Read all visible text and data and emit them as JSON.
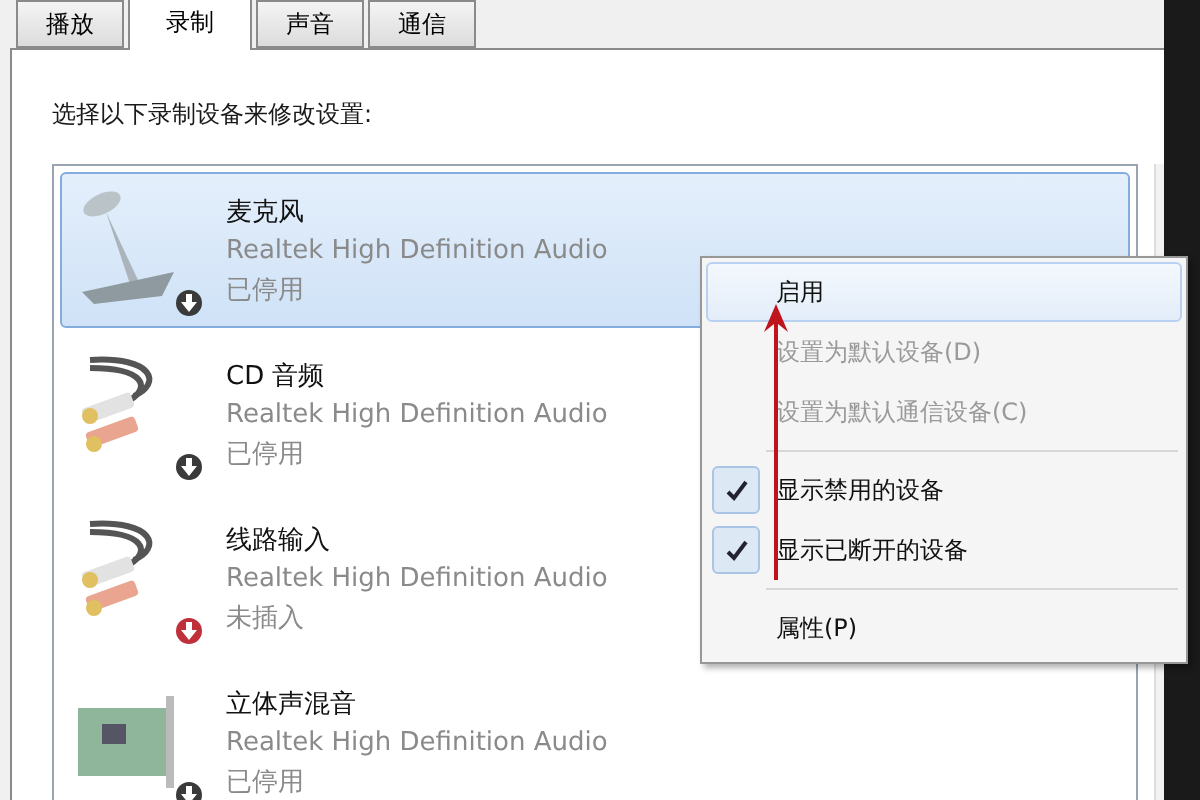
{
  "tabs": [
    {
      "label": "播放",
      "selected": false
    },
    {
      "label": "录制",
      "selected": true
    },
    {
      "label": "声音",
      "selected": false
    },
    {
      "label": "通信",
      "selected": false
    }
  ],
  "instruction": "选择以下录制设备来修改设置:",
  "devices": [
    {
      "kind": "microphone",
      "name": "麦克风",
      "driver": "Realtek High Definition Audio",
      "status": "已停用",
      "color": "#3a3a3a",
      "selected": true
    },
    {
      "kind": "cable",
      "name": "CD 音频",
      "driver": "Realtek High Definition Audio",
      "status": "已停用",
      "color": "#3a3a3a",
      "selected": false
    },
    {
      "kind": "cable",
      "name": "线路输入",
      "driver": "Realtek High Definition Audio",
      "status": "未插入",
      "color": "#c0303a",
      "selected": false
    },
    {
      "kind": "card",
      "name": "立体声混音",
      "driver": "Realtek High Definition Audio",
      "status": "已停用",
      "color": "#3a3a3a",
      "selected": false
    }
  ],
  "context_menu": {
    "groups": [
      [
        {
          "label": "启用",
          "disabled": false,
          "checked": false,
          "selected": true
        },
        {
          "label": "设置为默认设备(D)",
          "disabled": true,
          "checked": false,
          "selected": false
        },
        {
          "label": "设置为默认通信设备(C)",
          "disabled": true,
          "checked": false,
          "selected": false
        }
      ],
      [
        {
          "label": "显示禁用的设备",
          "disabled": false,
          "checked": true,
          "selected": false
        },
        {
          "label": "显示已断开的设备",
          "disabled": false,
          "checked": true,
          "selected": false
        }
      ],
      [
        {
          "label": "属性(P)",
          "disabled": false,
          "checked": false,
          "selected": false
        }
      ]
    ]
  }
}
